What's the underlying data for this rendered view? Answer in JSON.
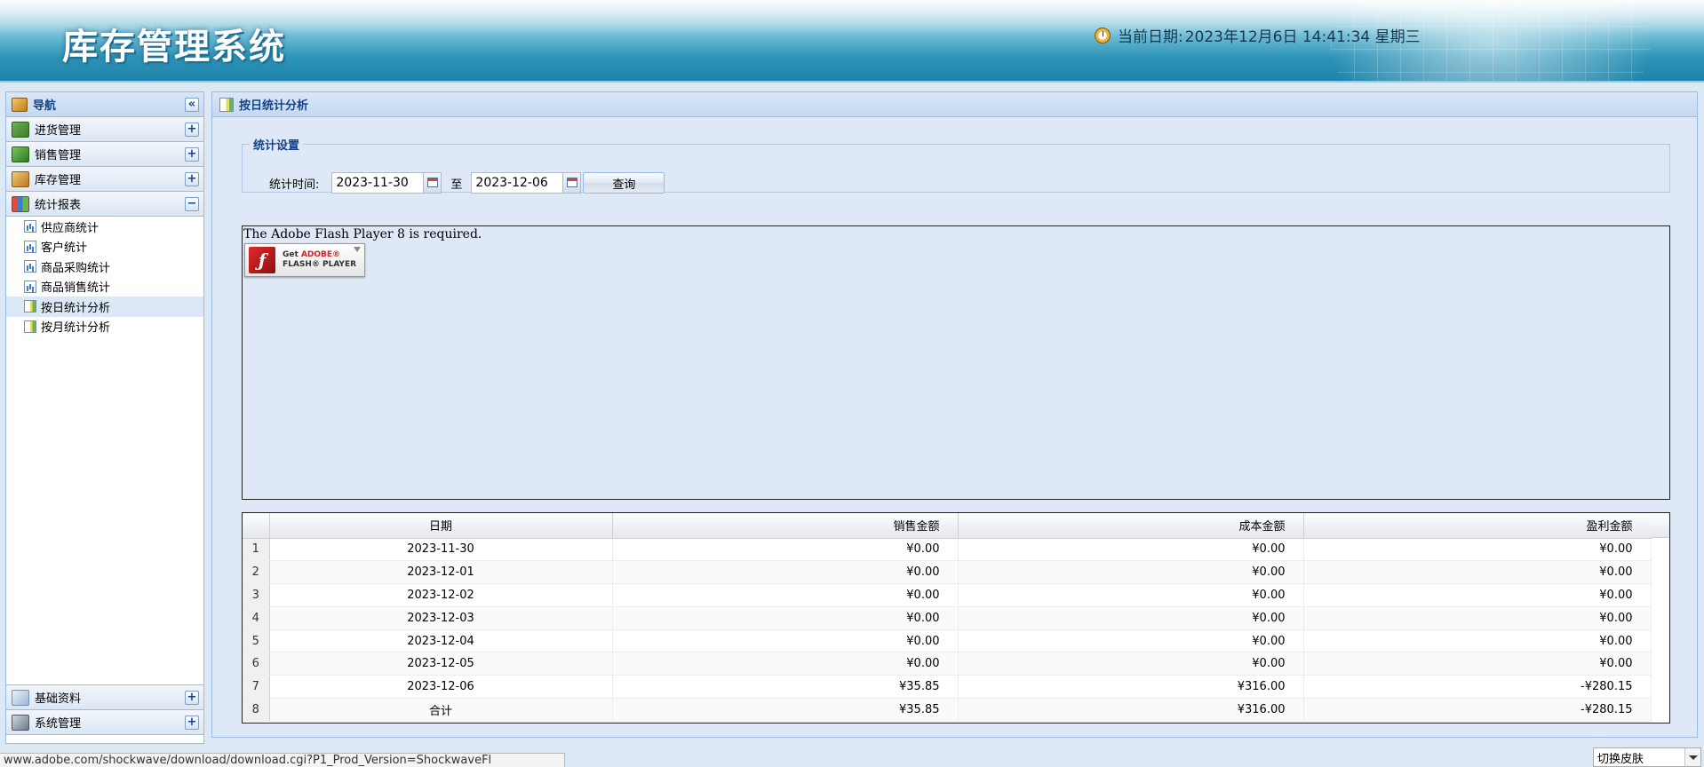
{
  "header": {
    "app_title": "库存管理系统",
    "date_label": "当前日期:",
    "date_value": "2023年12月6日 14:41:34 星期三"
  },
  "sidebar": {
    "title": "导航",
    "collapse_symbol": "«",
    "categories": [
      {
        "label": "进货管理",
        "toggle": "+"
      },
      {
        "label": "销售管理",
        "toggle": "+"
      },
      {
        "label": "库存管理",
        "toggle": "+"
      },
      {
        "label": "统计报表",
        "toggle": "−"
      }
    ],
    "report_items": [
      {
        "label": "供应商统计"
      },
      {
        "label": "客户统计"
      },
      {
        "label": "商品采购统计"
      },
      {
        "label": "商品销售统计"
      },
      {
        "label": "按日统计分析"
      },
      {
        "label": "按月统计分析"
      }
    ],
    "bottom_categories": [
      {
        "label": "基础资料",
        "toggle": "+"
      },
      {
        "label": "系统管理",
        "toggle": "+"
      }
    ]
  },
  "main": {
    "title": "按日统计分析",
    "settings_legend": "统计设置",
    "time_label": "统计时间:",
    "start_date": "2023-11-30",
    "to_label": "至",
    "end_date": "2023-12-06",
    "query_label": "查询",
    "flash_message": "The Adobe Flash Player 8 is required.",
    "flash_badge": {
      "get": "Get",
      "adobe": "ADOBE®",
      "product": "FLASH® PLAYER"
    }
  },
  "table": {
    "columns": [
      "日期",
      "销售金额",
      "成本金额",
      "盈利金额"
    ],
    "rows": [
      {
        "n": "1",
        "date": "2023-11-30",
        "sales": "¥0.00",
        "cost": "¥0.00",
        "profit": "¥0.00"
      },
      {
        "n": "2",
        "date": "2023-12-01",
        "sales": "¥0.00",
        "cost": "¥0.00",
        "profit": "¥0.00"
      },
      {
        "n": "3",
        "date": "2023-12-02",
        "sales": "¥0.00",
        "cost": "¥0.00",
        "profit": "¥0.00"
      },
      {
        "n": "4",
        "date": "2023-12-03",
        "sales": "¥0.00",
        "cost": "¥0.00",
        "profit": "¥0.00"
      },
      {
        "n": "5",
        "date": "2023-12-04",
        "sales": "¥0.00",
        "cost": "¥0.00",
        "profit": "¥0.00"
      },
      {
        "n": "6",
        "date": "2023-12-05",
        "sales": "¥0.00",
        "cost": "¥0.00",
        "profit": "¥0.00"
      },
      {
        "n": "7",
        "date": "2023-12-06",
        "sales": "¥35.85",
        "cost": "¥316.00",
        "profit": "-¥280.15"
      },
      {
        "n": "8",
        "date": "合计",
        "sales": "¥35.85",
        "cost": "¥316.00",
        "profit": "-¥280.15"
      }
    ]
  },
  "status": {
    "url": "www.adobe.com/shockwave/download/download.cgi?P1_Prod_Version=ShockwaveFl",
    "skin_label": "切换皮肤"
  }
}
